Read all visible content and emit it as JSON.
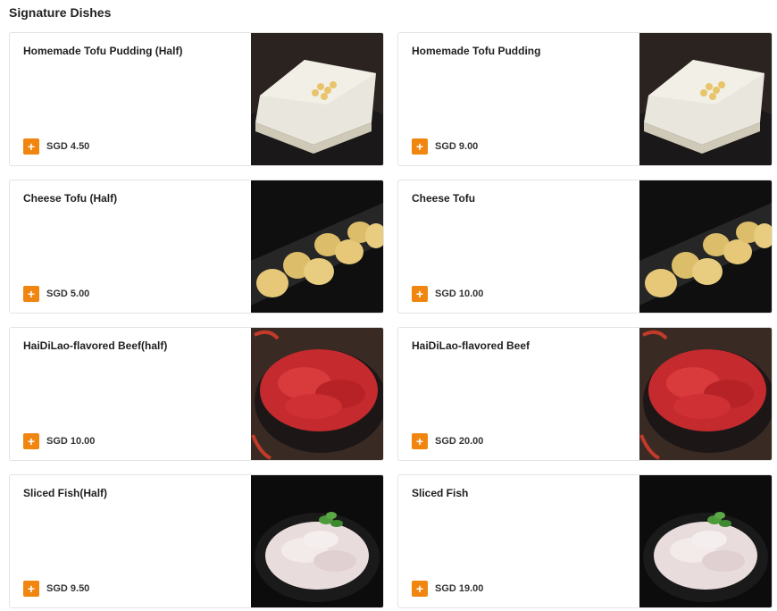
{
  "section": {
    "title": "Signature Dishes"
  },
  "add_symbol": "+",
  "items": [
    {
      "name": "Homemade Tofu Pudding (Half)",
      "price": "SGD 4.50",
      "image": "tofu-pudding-photo"
    },
    {
      "name": "Homemade Tofu Pudding",
      "price": "SGD 9.00",
      "image": "tofu-pudding-photo"
    },
    {
      "name": "Cheese Tofu (Half)",
      "price": "SGD 5.00",
      "image": "cheese-tofu-photo"
    },
    {
      "name": "Cheese Tofu",
      "price": "SGD 10.00",
      "image": "cheese-tofu-photo"
    },
    {
      "name": "HaiDiLao-flavored Beef(half)",
      "price": "SGD 10.00",
      "image": "beef-photo"
    },
    {
      "name": "HaiDiLao-flavored Beef",
      "price": "SGD 20.00",
      "image": "beef-photo"
    },
    {
      "name": "Sliced Fish(Half)",
      "price": "SGD 9.50",
      "image": "sliced-fish-photo"
    },
    {
      "name": "Sliced Fish",
      "price": "SGD 19.00",
      "image": "sliced-fish-photo"
    }
  ],
  "colors": {
    "accent": "#f0850f",
    "border": "#e3e3e3"
  }
}
